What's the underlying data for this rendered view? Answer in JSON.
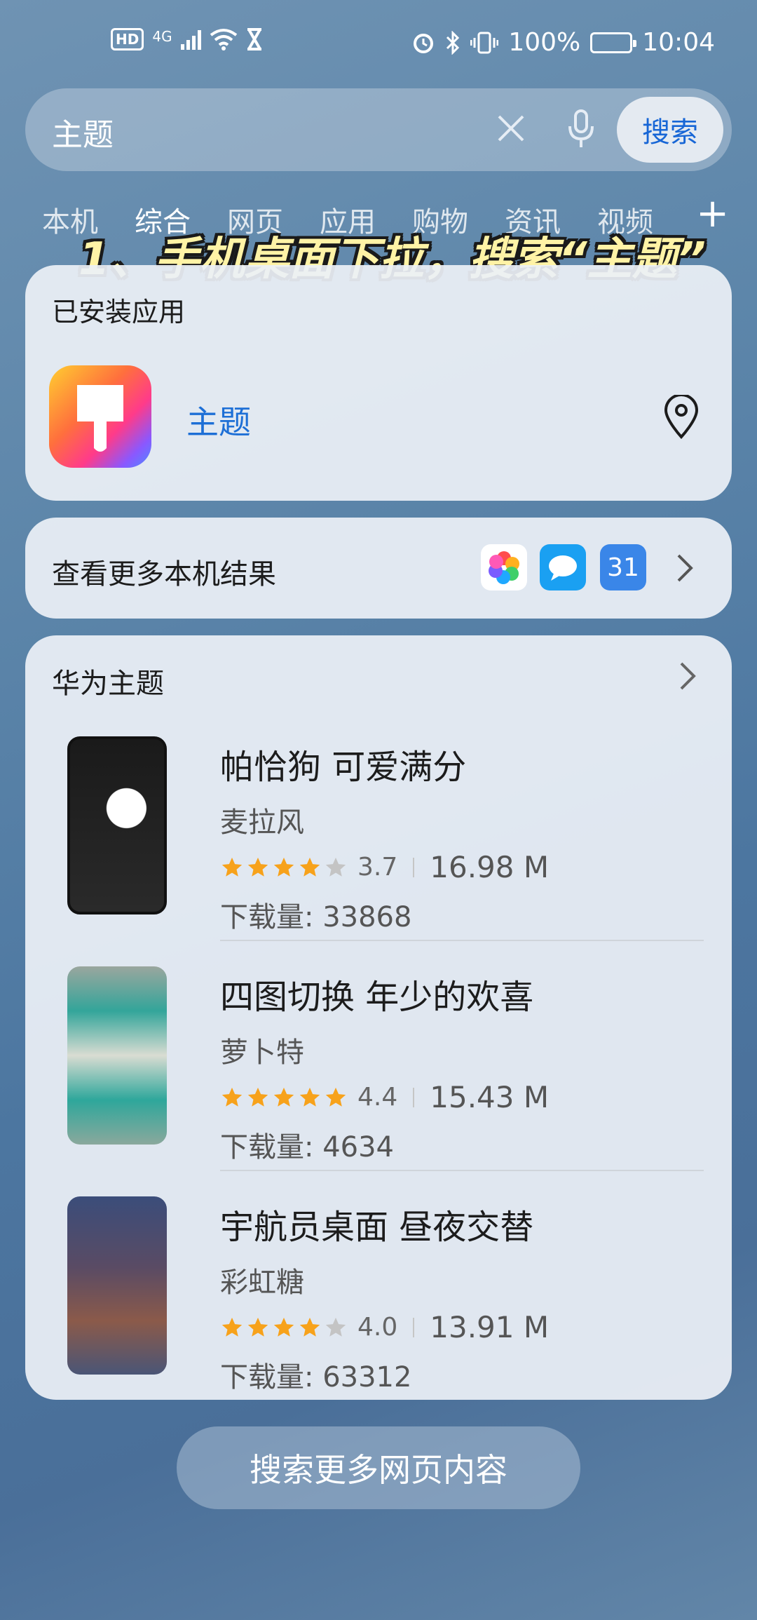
{
  "status_bar": {
    "hd": "HD",
    "network": "4G",
    "battery": "100%",
    "time": "10:04"
  },
  "search": {
    "query": "主题",
    "button": "搜索"
  },
  "tabs": [
    "本机",
    "综合",
    "网页",
    "应用",
    "购物",
    "资讯",
    "视频"
  ],
  "active_tab": "综合",
  "overlay_caption": "1、手机桌面下拉，搜索“主题”",
  "installed": {
    "label": "已安装应用",
    "app_name": "主题"
  },
  "more_local": {
    "label": "查看更多本机结果",
    "calendar_day": "31"
  },
  "themes": {
    "title": "华为主题",
    "items": [
      {
        "name": "帕恰狗 可爱满分",
        "author": "麦拉风",
        "rating": "3.7",
        "stars": 4,
        "size": "16.98 M",
        "downloads": "下载量: 33868"
      },
      {
        "name": "四图切换 年少的欢喜",
        "author": "萝卜特",
        "rating": "4.4",
        "stars": 5,
        "size": "15.43 M",
        "downloads": "下载量: 4634"
      },
      {
        "name": "宇航员桌面 昼夜交替",
        "author": "彩虹糖",
        "rating": "4.0",
        "stars": 4,
        "size": "13.91 M",
        "downloads": "下载量: 63312"
      }
    ]
  },
  "web_more_button": "搜索更多网页内容",
  "colors": {
    "accent": "#1766d6",
    "link": "#1d6fd6",
    "star": "#f7a21b",
    "star_empty": "#c4c4c4"
  }
}
